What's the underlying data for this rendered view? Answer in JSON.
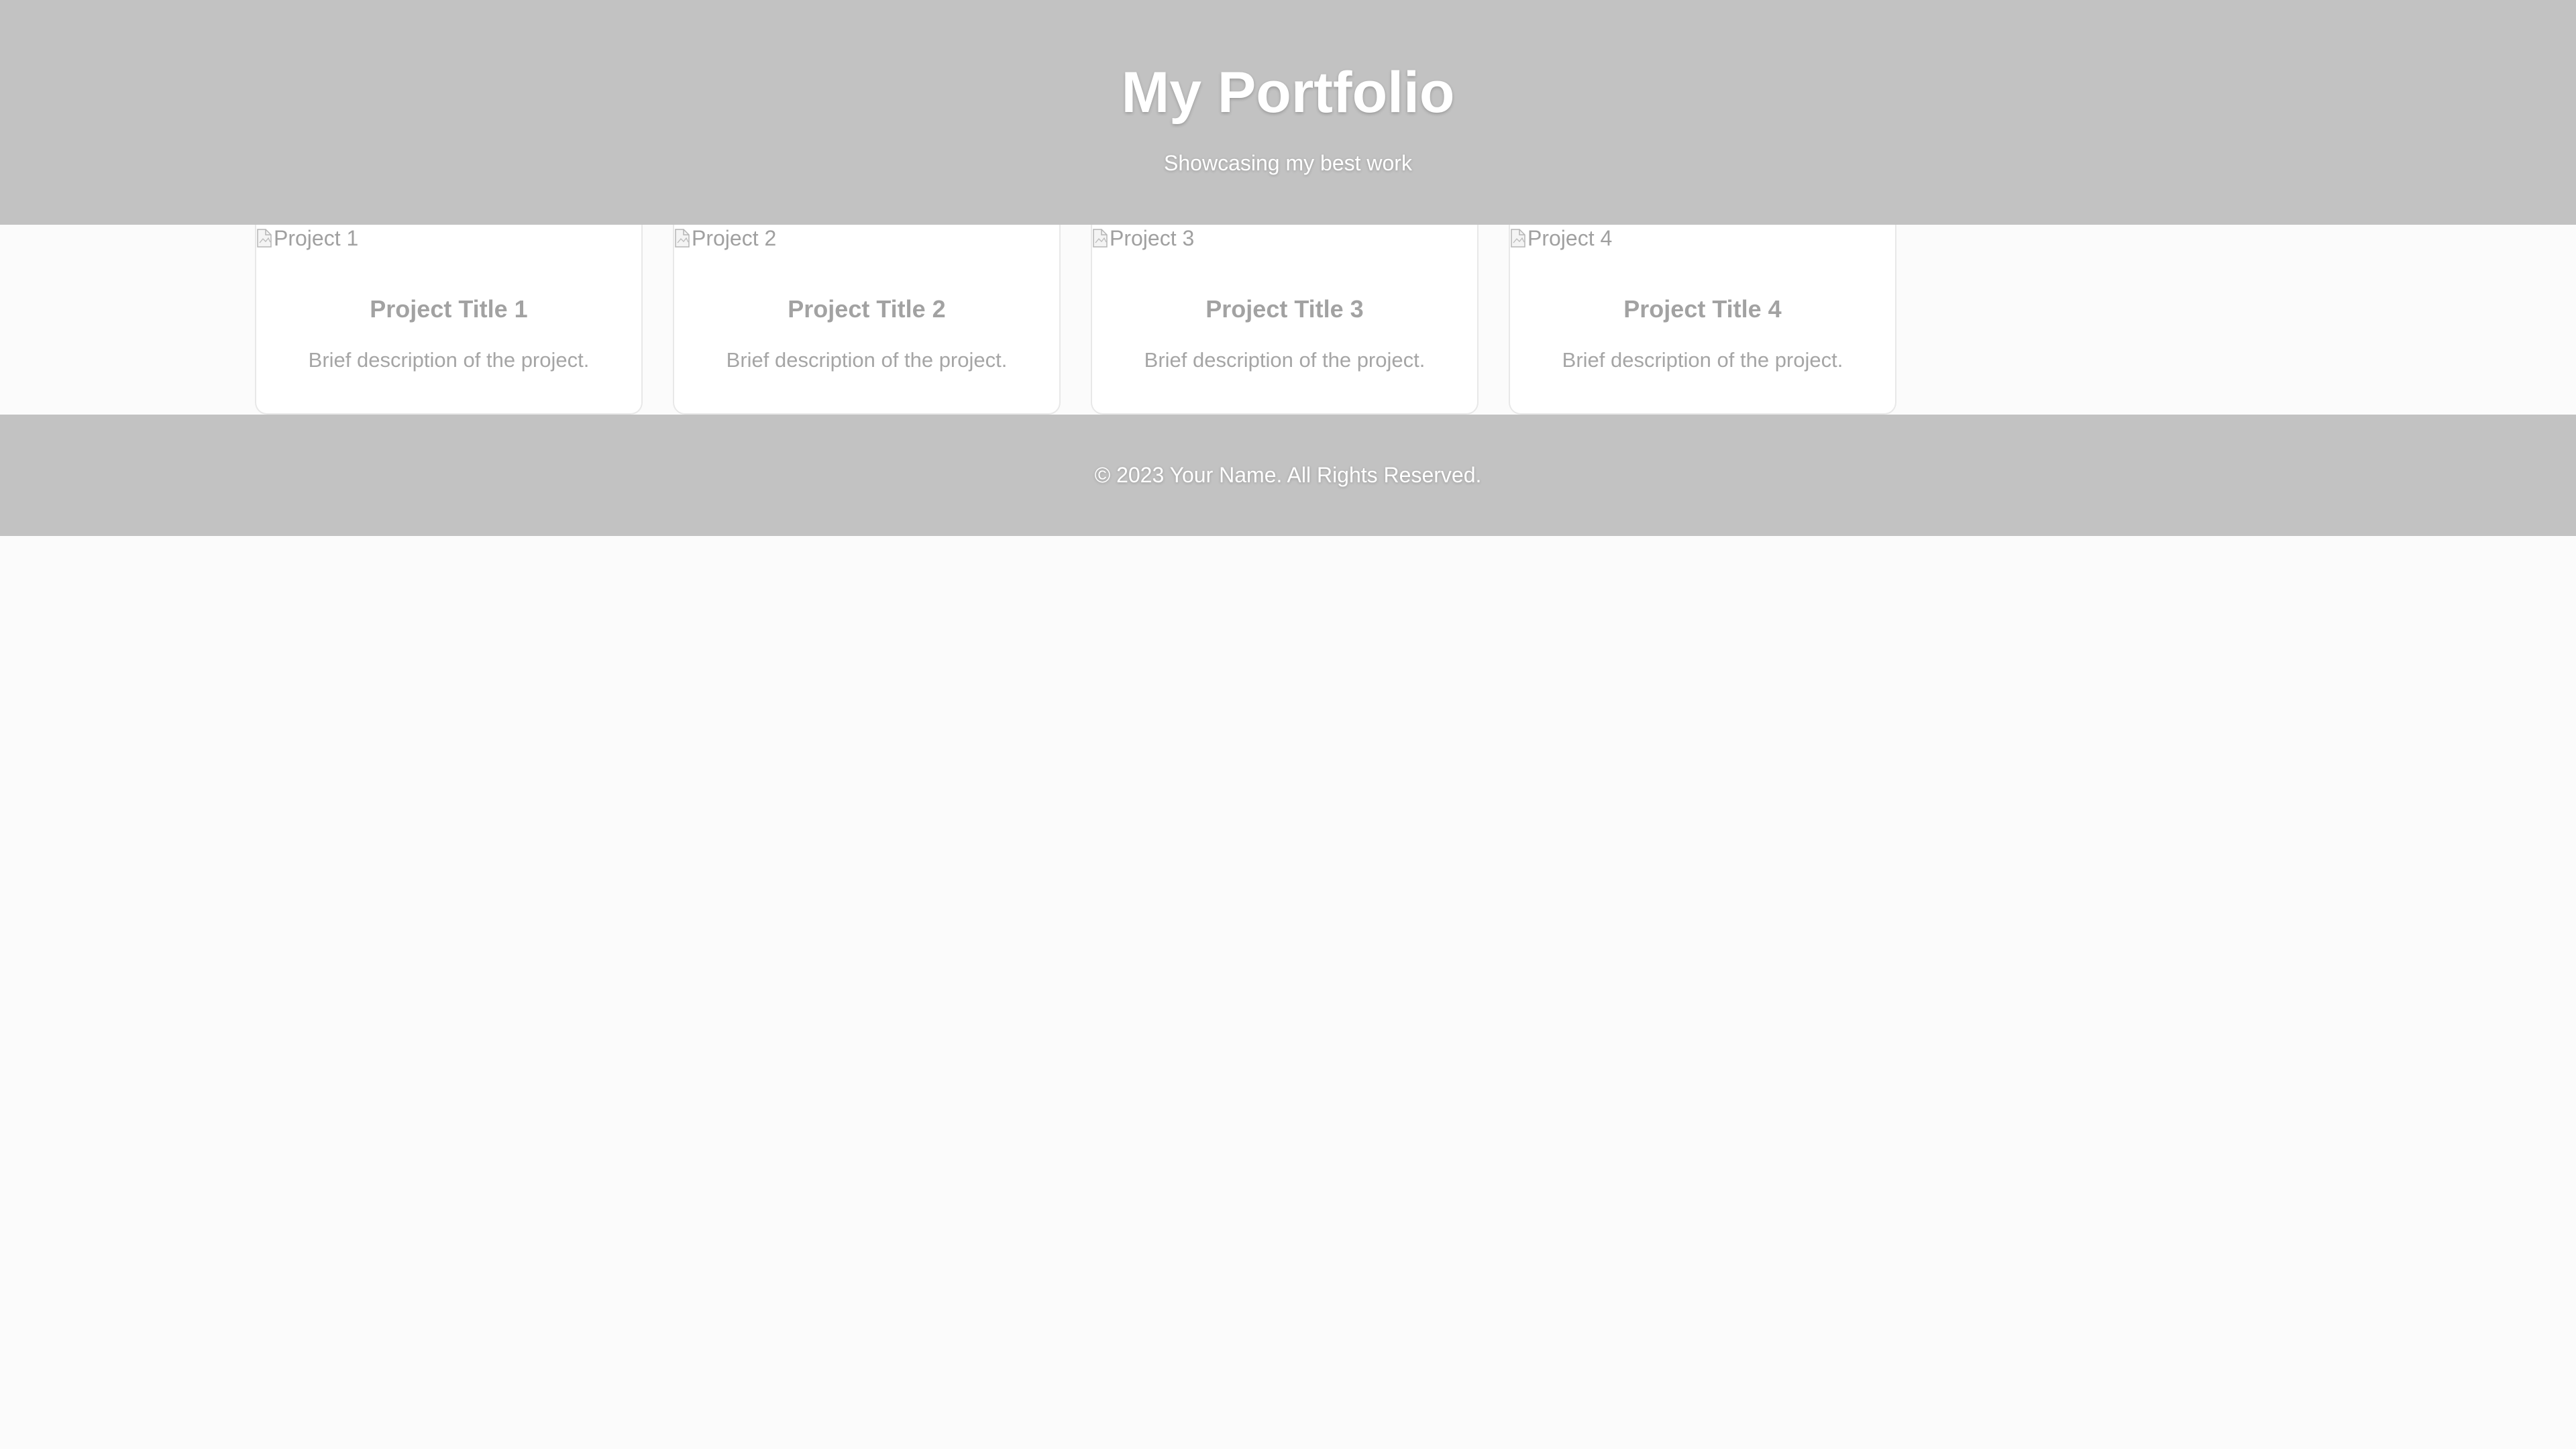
{
  "header": {
    "title": "My Portfolio",
    "subtitle": "Showcasing my best work"
  },
  "projects": [
    {
      "image_alt": "Project 1",
      "title": "Project Title 1",
      "description": "Brief description of the project."
    },
    {
      "image_alt": "Project 2",
      "title": "Project Title 2",
      "description": "Brief description of the project."
    },
    {
      "image_alt": "Project 3",
      "title": "Project Title 3",
      "description": "Brief description of the project."
    },
    {
      "image_alt": "Project 4",
      "title": "Project Title 4",
      "description": "Brief description of the project."
    }
  ],
  "footer": {
    "text": "© 2023 Your Name. All Rights Reserved."
  },
  "colors": {
    "header_background": "#c2c2c2",
    "page_background": "#fbfbfb",
    "card_background": "#ffffff",
    "muted_text": "#a2a2a2",
    "header_text": "#ffffff"
  },
  "icons": {
    "broken_image": "broken-image-icon"
  }
}
